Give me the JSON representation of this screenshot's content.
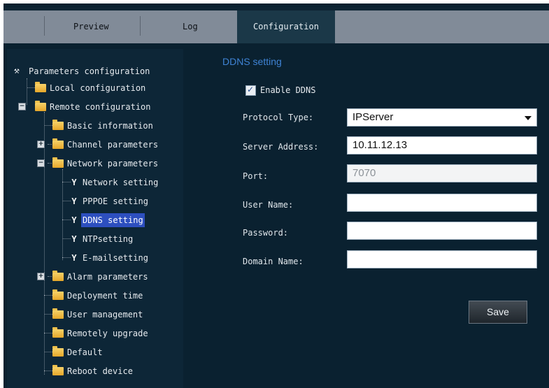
{
  "tabs": {
    "preview": "Preview",
    "log": "Log",
    "configuration": "Configuration"
  },
  "tree": {
    "root": "Parameters configuration",
    "local": "Local configuration",
    "remote": "Remote configuration",
    "basic": "Basic information",
    "channel": "Channel parameters",
    "network": "Network parameters",
    "network_setting": "Network setting",
    "pppoe": "PPPOE setting",
    "ddns": "DDNS setting",
    "ntp": "NTPsetting",
    "email": "E-mailsetting",
    "alarm": "Alarm parameters",
    "deployment": "Deployment time",
    "user_mgmt": "User management",
    "upgrade": "Remotely upgrade",
    "default": "Default",
    "reboot": "Reboot device"
  },
  "content": {
    "title": "DDNS setting",
    "enable_label": "Enable DDNS",
    "enable_checked": true,
    "protocol_label": "Protocol Type:",
    "protocol_value": "IPServer",
    "server_label": "Server Address:",
    "server_value": "10.11.12.13",
    "port_label": "Port:",
    "port_value": "7070",
    "user_label": "User Name:",
    "user_value": "",
    "password_label": "Password:",
    "password_value": "",
    "domain_label": "Domain Name:",
    "domain_value": "",
    "save_label": "Save"
  },
  "colors": {
    "background": "#0a2130",
    "tab_bar": "#818b98",
    "active_tab": "#1b3848",
    "title_blue": "#3f83d4",
    "selection": "#2d4fbf"
  }
}
